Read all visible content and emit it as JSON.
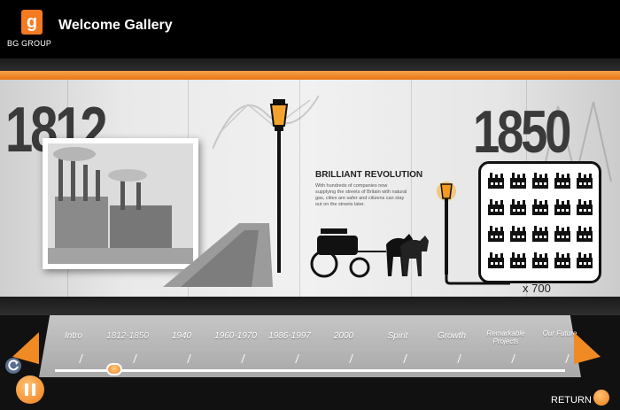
{
  "app": {
    "logo_letter": "g",
    "company": "BG GROUP",
    "title": "Welcome Gallery"
  },
  "exhibit": {
    "year_left": "1812",
    "year_right": "1850",
    "panel_title": "BRILLIANT REVOLUTION",
    "panel_body": "With hundreds of companies now supplying the streets of Britain with natural gas, cities are safer and citizens can stay out on the streets later.",
    "grid_count": "x 700",
    "grid_rows": 4,
    "grid_cols": 5
  },
  "timeline": {
    "eras": [
      {
        "label": "Intro",
        "active": false
      },
      {
        "label": "1812-1850",
        "active": true
      },
      {
        "label": "1940",
        "active": false
      },
      {
        "label": "1960-1970",
        "active": false
      },
      {
        "label": "1986-1997",
        "active": false
      },
      {
        "label": "2000",
        "active": false
      },
      {
        "label": "Spirit",
        "active": false
      },
      {
        "label": "Growth",
        "active": false
      },
      {
        "label": "Remarkable Projects",
        "active": false
      },
      {
        "label": "Our Future",
        "active": false
      }
    ],
    "return_label": "RETURN"
  },
  "colors": {
    "accent": "#f47a20",
    "header_bg": "#000000",
    "wall": "#ececec",
    "text_dark": "#3a3a3a"
  },
  "icons": [
    "logo-icon",
    "gas-lamp-icon",
    "horse-carriage-icon",
    "factory-icon",
    "pause-icon",
    "refresh-icon",
    "arrow-left-icon",
    "arrow-right-icon"
  ]
}
